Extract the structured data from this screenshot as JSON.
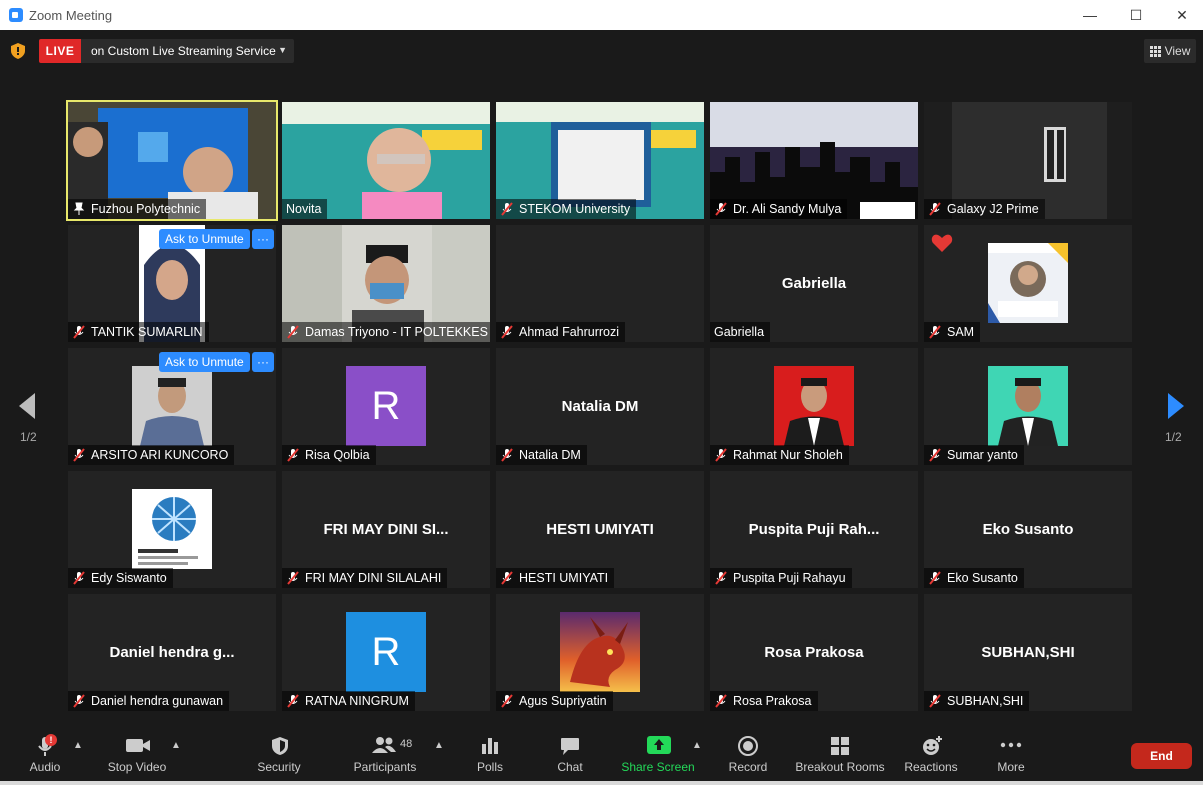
{
  "window": {
    "title": "Zoom Meeting",
    "minimize": "—",
    "maximize": "☐",
    "close": "✕"
  },
  "live": {
    "badge": "LIVE",
    "service": "on Custom Live Streaming Service"
  },
  "view": {
    "label": "View"
  },
  "pagination": {
    "left": "1/2",
    "right": "1/2"
  },
  "ask_unmute": "Ask to Unmute",
  "more_dots": "···",
  "tiles": [
    {
      "name": "Fuzhou Polytechnic",
      "type": "video",
      "active": true,
      "muted": false
    },
    {
      "name": "Novita",
      "type": "video",
      "muted": false
    },
    {
      "name": "STEKOM University",
      "type": "video",
      "muted": true
    },
    {
      "name": "Dr. Ali Sandy Mulya",
      "type": "video",
      "muted": true
    },
    {
      "name": "Galaxy J2 Prime",
      "type": "video",
      "muted": true
    },
    {
      "name": "TANTIK SUMARLIN",
      "type": "photo",
      "muted": true
    },
    {
      "name": "Damas Triyono - IT POLTEKKES",
      "type": "video",
      "muted": true
    },
    {
      "name": "Ahmad Fahrurrozi",
      "type": "blank",
      "muted": true
    },
    {
      "name": "Gabriella",
      "display": "Gabriella",
      "type": "name",
      "muted": false
    },
    {
      "name": "SAM",
      "type": "photo",
      "muted": true,
      "reaction": "heart"
    },
    {
      "name": "ARSITO ARI KUNCORO",
      "type": "photo",
      "muted": true
    },
    {
      "name": "Risa Qolbia",
      "type": "letter",
      "letter": "R",
      "color": "#8a4fc8",
      "muted": true
    },
    {
      "name": "Natalia DM",
      "display": "Natalia DM",
      "type": "name",
      "muted": true
    },
    {
      "name": "Rahmat Nur Sholeh",
      "type": "photo",
      "muted": true
    },
    {
      "name": "Sumar yanto",
      "type": "photo",
      "muted": true
    },
    {
      "name": "Edy Siswanto",
      "type": "photo",
      "muted": true
    },
    {
      "name": "FRI MAY DINI SILALAHI",
      "display": "FRI MAY DINI SI...",
      "type": "name",
      "muted": true
    },
    {
      "name": "HESTI UMIYATI",
      "display": "HESTI UMIYATI",
      "type": "name",
      "muted": true
    },
    {
      "name": "Puspita Puji Rahayu",
      "display": "Puspita Puji Rah...",
      "type": "name",
      "muted": true
    },
    {
      "name": "Eko Susanto",
      "display": "Eko Susanto",
      "type": "name",
      "muted": true
    },
    {
      "name": "Daniel hendra gunawan",
      "display": "Daniel hendra g...",
      "type": "name",
      "muted": true
    },
    {
      "name": "RATNA NINGRUM",
      "type": "letter",
      "letter": "R",
      "color": "#1e8fe0",
      "muted": true
    },
    {
      "name": "Agus Supriyatin",
      "type": "photo",
      "muted": true
    },
    {
      "name": "Rosa Prakosa",
      "display": "Rosa Prakosa",
      "type": "name",
      "muted": true
    },
    {
      "name": "SUBHAN,SHI",
      "display": "SUBHAN,SHI",
      "type": "name",
      "muted": true
    }
  ],
  "toolbar": {
    "audio": "Audio",
    "stop_video": "Stop Video",
    "security": "Security",
    "participants": "Participants",
    "participants_count": "48",
    "polls": "Polls",
    "chat": "Chat",
    "share_screen": "Share Screen",
    "record": "Record",
    "breakout_rooms": "Breakout Rooms",
    "reactions": "Reactions",
    "more": "More",
    "end": "End",
    "audio_alert": "!"
  },
  "colors": {
    "accent": "#2d8cff",
    "live": "#e02828",
    "end": "#c4281c",
    "share": "#23d959",
    "active_border": "#e8e86b"
  }
}
